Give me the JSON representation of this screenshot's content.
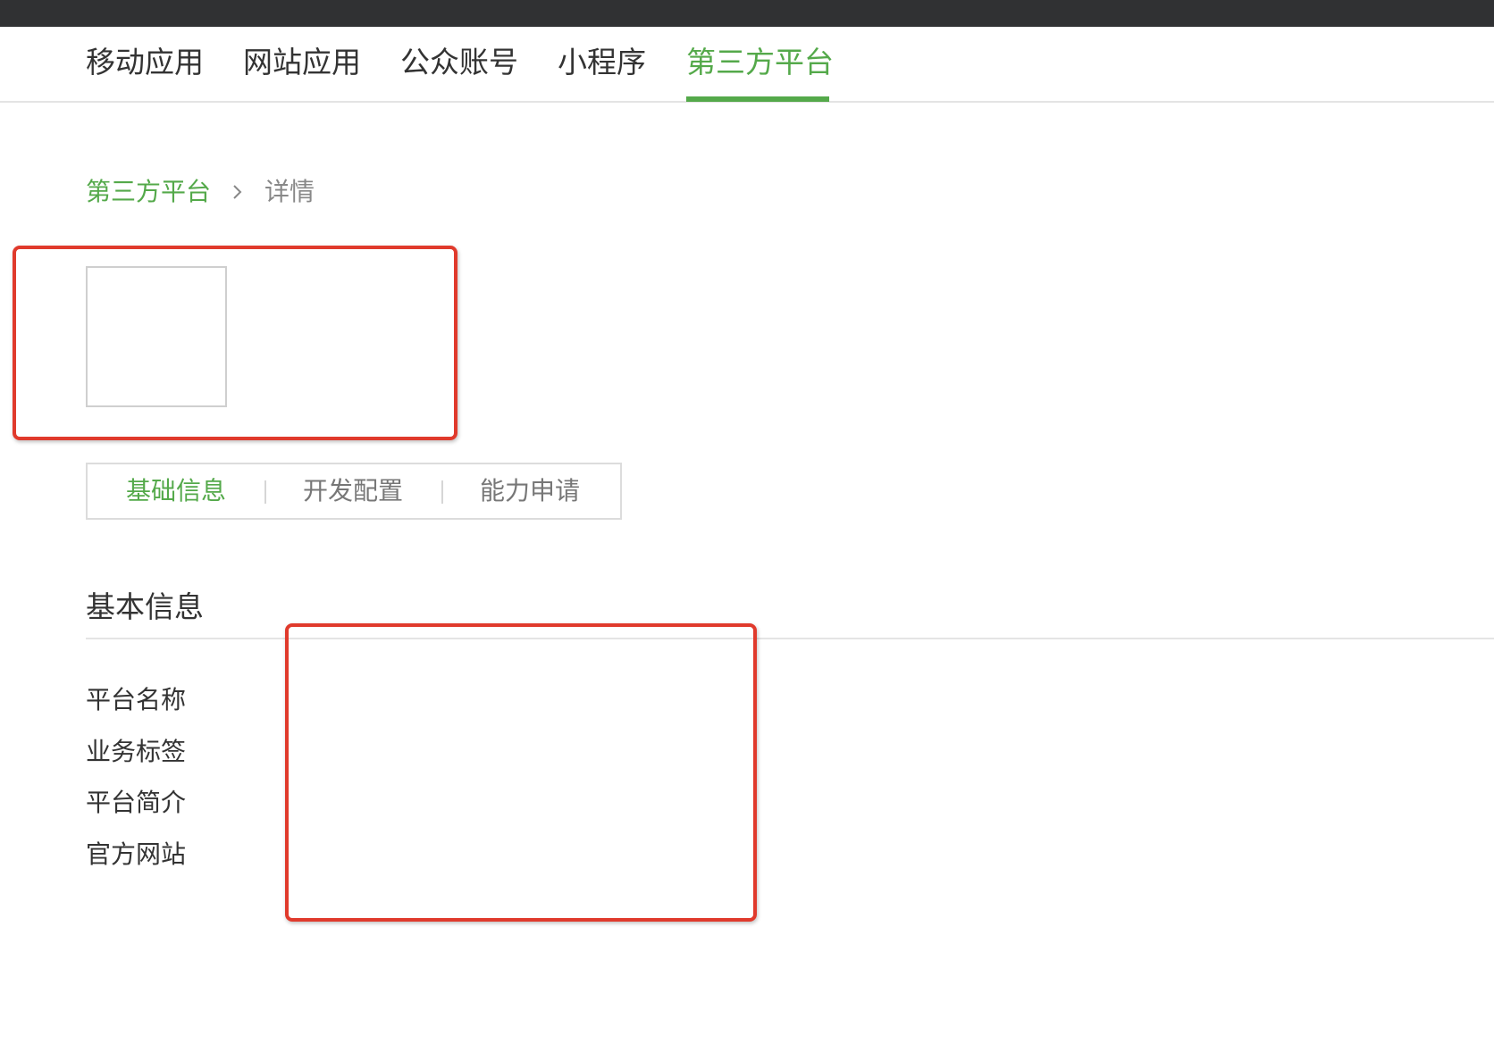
{
  "nav": {
    "tabs": [
      {
        "label": "移动应用",
        "active": false
      },
      {
        "label": "网站应用",
        "active": false
      },
      {
        "label": "公众账号",
        "active": false
      },
      {
        "label": "小程序",
        "active": false
      },
      {
        "label": "第三方平台",
        "active": true
      }
    ]
  },
  "breadcrumb": {
    "parent": "第三方平台",
    "separator_icon": "chevron-right-icon",
    "current": "详情"
  },
  "detail_tabs": [
    {
      "label": "基础信息",
      "active": true
    },
    {
      "label": "开发配置",
      "active": false
    },
    {
      "label": "能力申请",
      "active": false
    }
  ],
  "basic_info": {
    "title": "基本信息",
    "fields": [
      {
        "label": "平台名称"
      },
      {
        "label": "业务标签"
      },
      {
        "label": "平台简介"
      },
      {
        "label": "官方网站"
      }
    ]
  },
  "colors": {
    "accent": "#54a94a",
    "top_bar": "#303133",
    "annotation": "#e03a2c"
  }
}
